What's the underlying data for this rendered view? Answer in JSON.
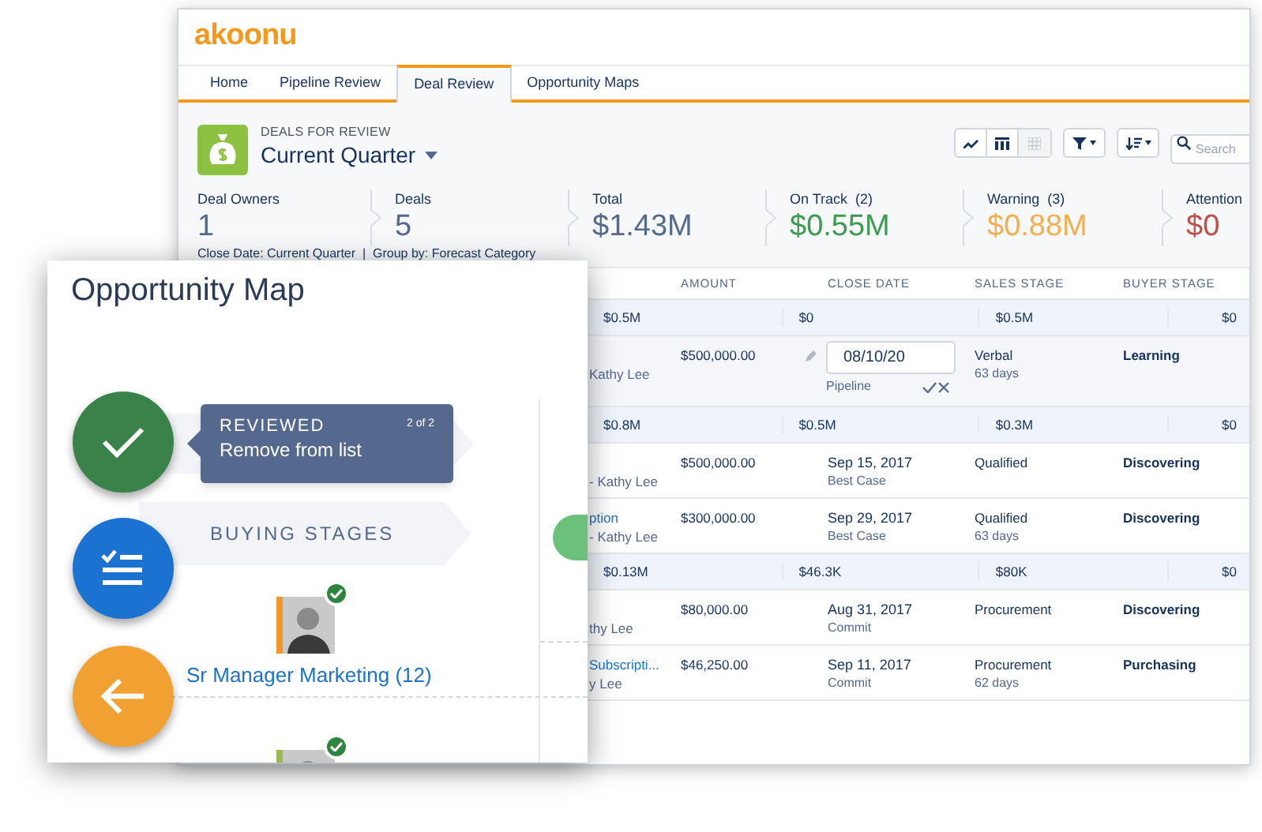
{
  "app": {
    "logo": "akoonu",
    "tabs": [
      {
        "label": "Home",
        "selected": false
      },
      {
        "label": "Pipeline Review",
        "selected": false
      },
      {
        "label": "Deal Review",
        "selected": true
      },
      {
        "label": "Opportunity Maps",
        "selected": false
      }
    ]
  },
  "header": {
    "eyebrow": "DEALS FOR REVIEW",
    "title": "Current Quarter",
    "search_placeholder": "Search"
  },
  "metrics": [
    {
      "label": "Deal Owners",
      "value": "1",
      "color": "#54698d"
    },
    {
      "label": "Deals",
      "value": "5",
      "color": "#54698d"
    },
    {
      "label": "Total",
      "value": "$1.43M",
      "color": "#54698d"
    },
    {
      "label": "On Track  (2)",
      "value": "$0.55M",
      "color": "#3c9b4e"
    },
    {
      "label": "Warning  (3)",
      "value": "$0.88M",
      "color": "#f3ae4e"
    },
    {
      "label": "Attention",
      "value": "$0",
      "color": "#c2504a"
    }
  ],
  "filter_summary": "Close Date: Current Quarter  |  Group by: Forecast Category",
  "table": {
    "columns": [
      "AMOUNT",
      "CLOSE DATE",
      "SALES STAGE",
      "BUYER STAGE"
    ],
    "rows": [
      {
        "kind": "group",
        "cells": [
          "$0.5M",
          "$0",
          "$0.5M",
          "$0"
        ]
      },
      {
        "kind": "deal",
        "owner": "Kathy Lee",
        "amount": "$500,000.00",
        "editing": true,
        "close_date": "08/10/20",
        "category": "Pipeline",
        "sales_stage": "Verbal",
        "age": "63 days",
        "buyer_stage": "Learning"
      },
      {
        "kind": "group",
        "cells": [
          "$0.8M",
          "$0.5M",
          "$0.3M",
          "$0"
        ]
      },
      {
        "kind": "deal",
        "owner": "- Kathy Lee",
        "amount": "$500,000.00",
        "editing": false,
        "close_date": "Sep 15, 2017",
        "category": "Best Case",
        "sales_stage": "Qualified",
        "buyer_stage": "Discovering"
      },
      {
        "kind": "deal",
        "name": "ption",
        "owner": "- Kathy Lee",
        "amount": "$300,000.00",
        "editing": false,
        "close_date": "Sep 29, 2017",
        "category": "Best Case",
        "sales_stage": "Qualified",
        "age": "63 days",
        "buyer_stage": "Discovering"
      },
      {
        "kind": "group",
        "cells": [
          "$0.13M",
          "$46.3K",
          "$80K",
          "$0"
        ]
      },
      {
        "kind": "deal",
        "owner": "thy Lee",
        "amount": "$80,000.00",
        "editing": false,
        "close_date": "Aug 31, 2017",
        "category": "Commit",
        "sales_stage": "Procurement",
        "buyer_stage": "Discovering"
      },
      {
        "kind": "deal",
        "name": "Subscripti...",
        "owner": "y Lee",
        "amount": "$46,250.00",
        "editing": false,
        "close_date": "Sep 11, 2017",
        "category": "Commit",
        "sales_stage": "Procurement",
        "age": "62 days",
        "buyer_stage": "Purchasing"
      }
    ]
  },
  "opportunity_map": {
    "title": "Opportunity Map",
    "tooltip": {
      "title": "REVIEWED",
      "text": "Remove from list",
      "count": "2 of 2"
    },
    "section": "BUYING STAGES",
    "contacts": [
      {
        "label": "Sr Manager Marketing (12)",
        "reviewed": true,
        "color": "#f0962a"
      },
      {
        "reviewed": true,
        "color": "#9ab94e"
      }
    ]
  }
}
